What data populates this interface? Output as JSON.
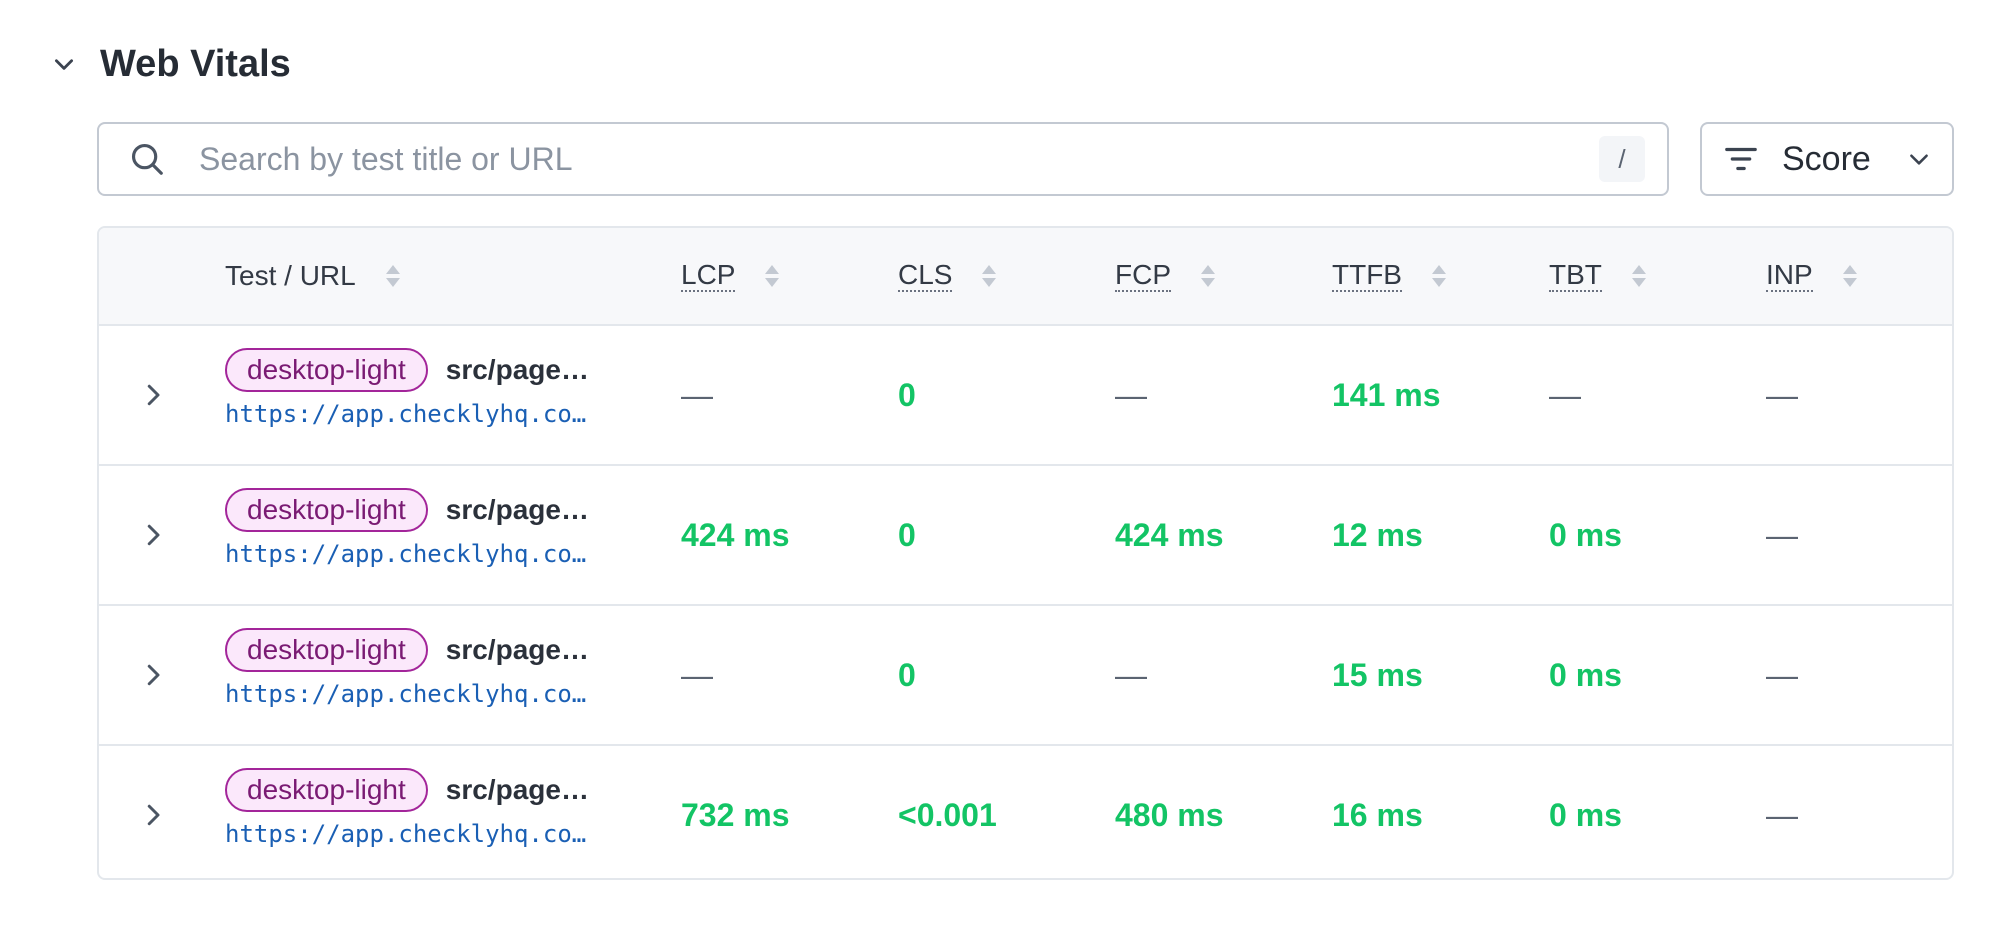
{
  "section": {
    "title": "Web Vitals"
  },
  "search": {
    "placeholder": "Search by test title or URL",
    "value": "",
    "shortcut": "/"
  },
  "filter": {
    "label": "Score"
  },
  "table": {
    "columns": [
      "Test / URL",
      "LCP",
      "CLS",
      "FCP",
      "TTFB",
      "TBT",
      "INP"
    ],
    "rows": [
      {
        "tag": "desktop-light",
        "name": "src/page…",
        "url": "https://app.checklyhq.co…",
        "lcp": "—",
        "cls": "0",
        "fcp": "—",
        "ttfb": "141 ms",
        "tbt": "—",
        "inp": "—"
      },
      {
        "tag": "desktop-light",
        "name": "src/page…",
        "url": "https://app.checklyhq.co…",
        "lcp": "424 ms",
        "cls": "0",
        "fcp": "424 ms",
        "ttfb": "12 ms",
        "tbt": "0 ms",
        "inp": "—"
      },
      {
        "tag": "desktop-light",
        "name": "src/page…",
        "url": "https://app.checklyhq.co…",
        "lcp": "—",
        "cls": "0",
        "fcp": "—",
        "ttfb": "15 ms",
        "tbt": "0 ms",
        "inp": "—"
      },
      {
        "tag": "desktop-light",
        "name": "src/page…",
        "url": "https://app.checklyhq.co…",
        "lcp": "732 ms",
        "cls": "<0.001",
        "fcp": "480 ms",
        "ttfb": "16 ms",
        "tbt": "0 ms",
        "inp": "—"
      }
    ]
  },
  "colors": {
    "good": "#13c465",
    "empty": "#5b6472",
    "tag_border": "#a3259a",
    "tag_bg": "#fbe8fb",
    "tag_text": "#7a1a73",
    "link": "#1a5fb4"
  },
  "icons": {
    "collapse": "chevron-down-icon",
    "search": "search-icon",
    "filter": "filter-icon",
    "dropdown": "chevron-down-icon",
    "sort": "sort-icon",
    "expand": "chevron-right-icon"
  }
}
